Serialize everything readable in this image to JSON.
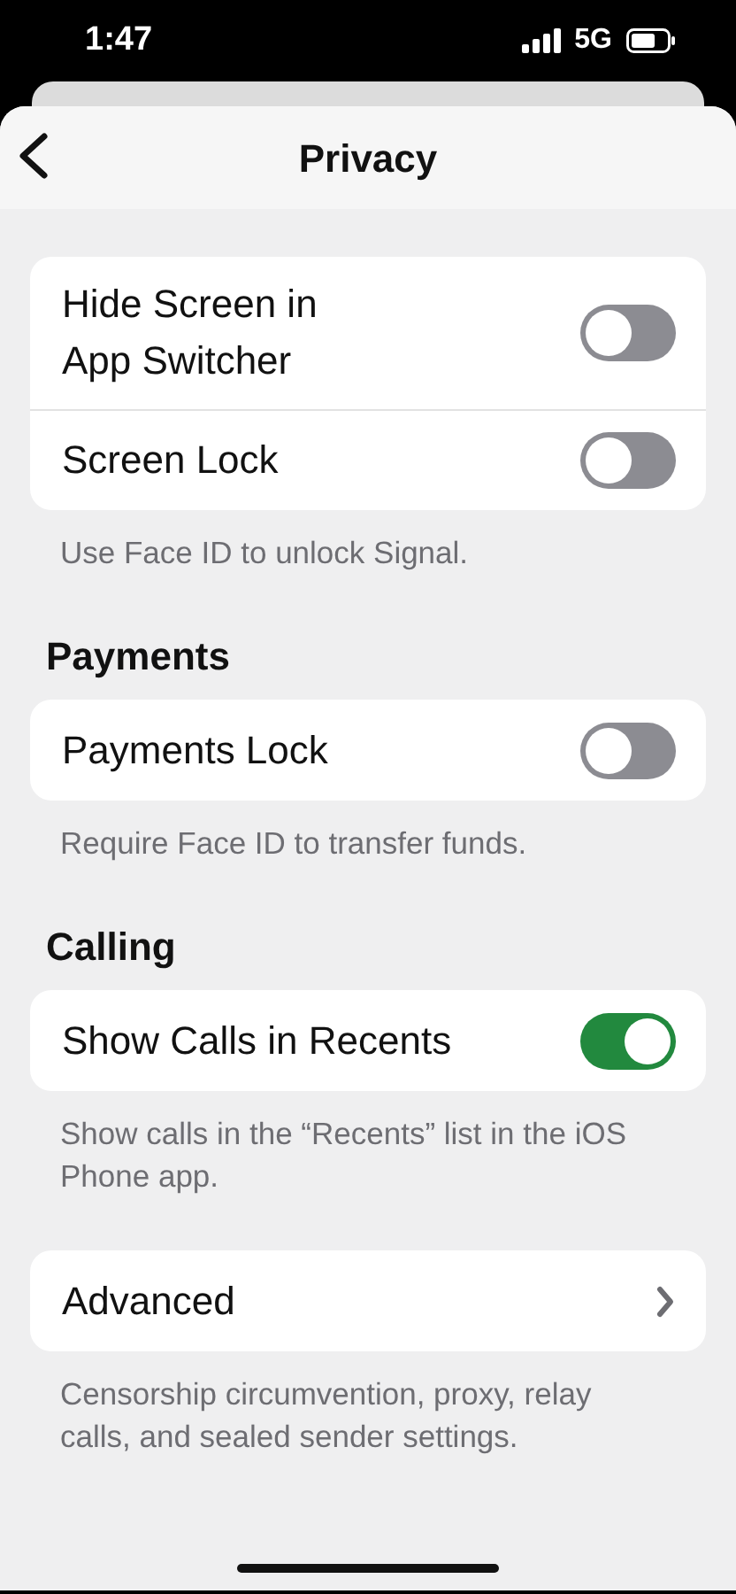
{
  "status_bar": {
    "time": "1:47",
    "network": "5G"
  },
  "nav": {
    "title": "Privacy"
  },
  "sections": [
    {
      "items": [
        {
          "kind": "toggle",
          "label": "Hide Screen in\nApp Switcher",
          "on": false
        },
        {
          "kind": "toggle",
          "label": "Screen Lock",
          "on": false
        }
      ],
      "footer": "Use Face ID to unlock Signal."
    },
    {
      "header": "Payments",
      "items": [
        {
          "kind": "toggle",
          "label": "Payments Lock",
          "on": false
        }
      ],
      "footer": "Require Face ID to transfer funds."
    },
    {
      "header": "Calling",
      "items": [
        {
          "kind": "toggle",
          "label": "Show Calls in Recents",
          "on": true
        }
      ],
      "footer": "Show calls in the “Recents” list in the iOS Phone app."
    },
    {
      "items": [
        {
          "kind": "link",
          "label": "Advanced"
        }
      ],
      "footer": "Censorship circumvention, proxy, relay calls, and sealed sender settings."
    }
  ]
}
